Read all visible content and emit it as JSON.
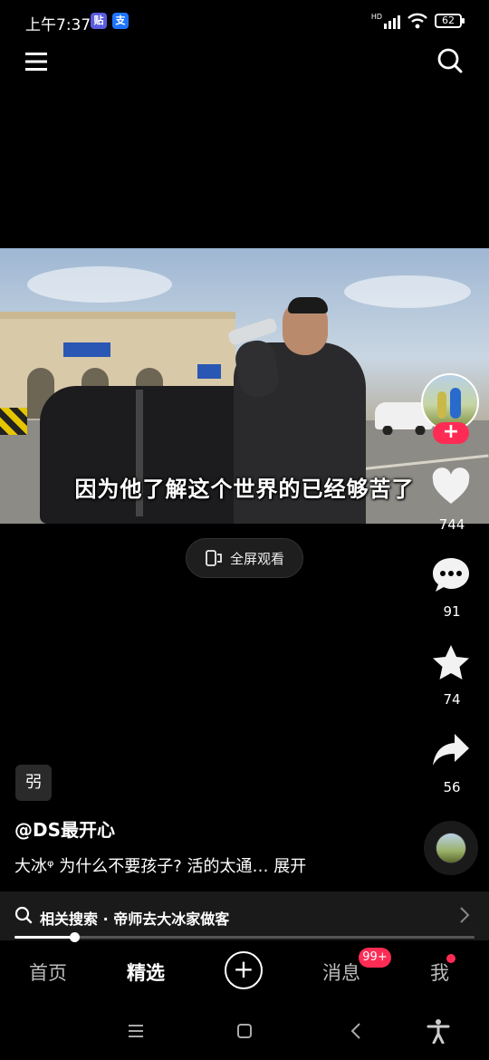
{
  "status_bar": {
    "time": "上午7:37",
    "badge1": "贴",
    "badge2": "支",
    "signal_label": "HD",
    "battery": "62"
  },
  "video": {
    "subtitle": "因为他了解这个世界的已经够苦了"
  },
  "fullscreen_label": "全屏观看",
  "rail": {
    "likes": "744",
    "comments": "91",
    "favorites": "74",
    "shares": "56",
    "follow_label": "+"
  },
  "caption": {
    "tag_chip": "弜",
    "author": "@DS最开心",
    "text": "大冰ᵠ  为什么不要孩子? 活的太通…",
    "expand": "展开"
  },
  "related_search": {
    "label": "相关搜索 · 帝师去大冰家做客"
  },
  "progress": {
    "value": 0.13
  },
  "tabs": [
    {
      "label": "首页"
    },
    {
      "label": "精选"
    },
    {
      "label": "+"
    },
    {
      "label": "消息"
    },
    {
      "label": "我"
    }
  ],
  "messages_badge": "99+",
  "colors": {
    "accent": "#fe2c55",
    "background": "#000000"
  }
}
